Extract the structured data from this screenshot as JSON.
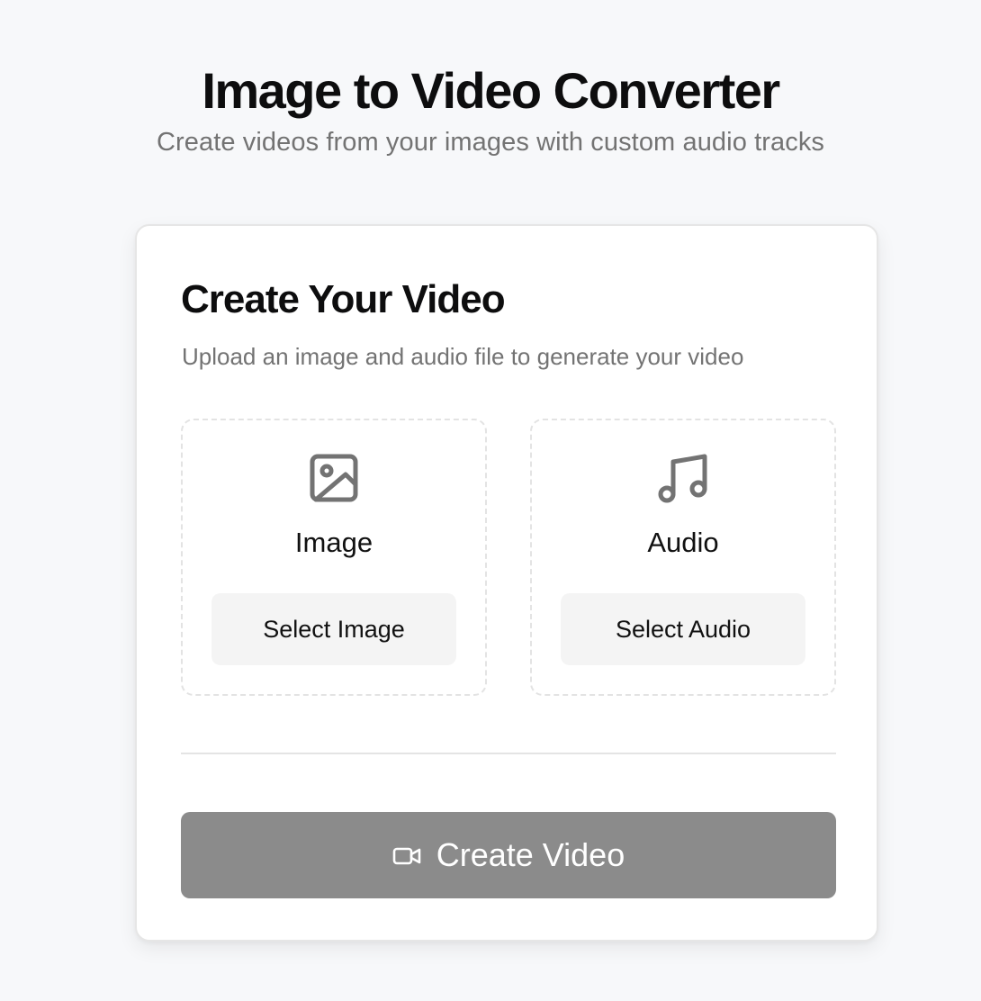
{
  "header": {
    "title": "Image to Video Converter",
    "subtitle": "Create videos from your images with custom audio tracks"
  },
  "card": {
    "title": "Create Your Video",
    "description": "Upload an image and audio file to generate your video"
  },
  "uploads": [
    {
      "icon": "image-icon",
      "label": "Image",
      "button_label": "Select Image"
    },
    {
      "icon": "music-note-icon",
      "label": "Audio",
      "button_label": "Select Audio"
    }
  ],
  "actions": {
    "create_label": "Create Video",
    "create_icon": "video-camera-icon",
    "create_disabled": true
  },
  "colors": {
    "page_background": "#f7f8fa",
    "card_background": "#ffffff",
    "muted_text": "#737373",
    "secondary_button": "#f4f4f4",
    "primary_button_disabled": "#8b8b8b"
  }
}
